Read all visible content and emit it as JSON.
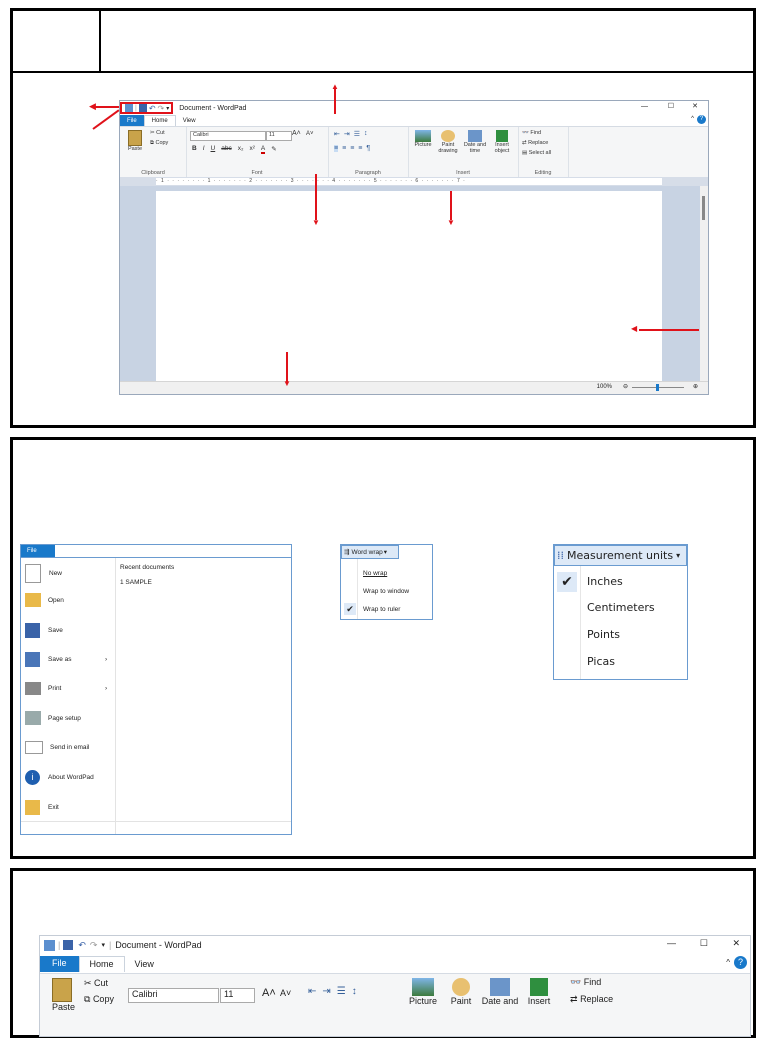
{
  "window": {
    "title": "Document - WordPad",
    "tabs": [
      "File",
      "Home",
      "View"
    ],
    "minimize_icon": "minimize-icon",
    "maximize_icon": "maximize-icon",
    "close_icon": "close-icon"
  },
  "ribbon": {
    "clipboard": {
      "paste": "Paste",
      "cut": "Cut",
      "copy": "Copy",
      "label": "Clipboard"
    },
    "font": {
      "family": "Calibri",
      "size": "11",
      "bold": "B",
      "italic": "I",
      "underline": "U",
      "strike": "abc",
      "sub": "x₂",
      "sup": "x²",
      "label": "Font"
    },
    "paragraph": {
      "label": "Paragraph"
    },
    "insert": {
      "picture": "Picture",
      "paint": "Paint drawing",
      "datetime": "Date and time",
      "object": "Insert object",
      "label": "Insert"
    },
    "editing": {
      "find": "Find",
      "replace": "Replace",
      "select_all": "Select all",
      "label": "Editing"
    }
  },
  "ruler": {
    "text": "· 1 · · · · · · · · 1 · · · · · · · 2 · · · · · · · 3 · · · · · · · 4 · · · · · · · 5 · · · · · · · 6 · · · · · · · 7 ·"
  },
  "status": {
    "zoom": "100%"
  },
  "file_menu": {
    "tab": "File",
    "items": [
      "New",
      "Open",
      "Save",
      "Save as",
      "Print",
      "Page setup",
      "Send in email",
      "About WordPad",
      "Exit"
    ],
    "recent_title": "Recent documents",
    "recent": [
      "1  SAMPLE"
    ]
  },
  "wordwrap_menu": {
    "button": "Word wrap",
    "items": [
      "No wrap",
      "Wrap to window",
      "Wrap to ruler"
    ],
    "checked": "Wrap to ruler"
  },
  "units_menu": {
    "button": "Measurement units",
    "items": [
      "Inches",
      "Centimeters",
      "Points",
      "Picas"
    ],
    "checked": "Inches"
  },
  "bottom_window": {
    "title": "Document - WordPad",
    "tabs": [
      "File",
      "Home",
      "View"
    ],
    "cut": "Cut",
    "copy": "Copy",
    "paste": "Paste",
    "font": "Calibri",
    "size": "11",
    "find": "Find",
    "replace": "Replace",
    "picture": "Picture",
    "paint": "Paint",
    "datetime": "Date and",
    "insert": "Insert"
  },
  "colors": {
    "accent": "#1979ca",
    "arrow": "#e0121a",
    "doc_bg": "#c8d3e3"
  }
}
